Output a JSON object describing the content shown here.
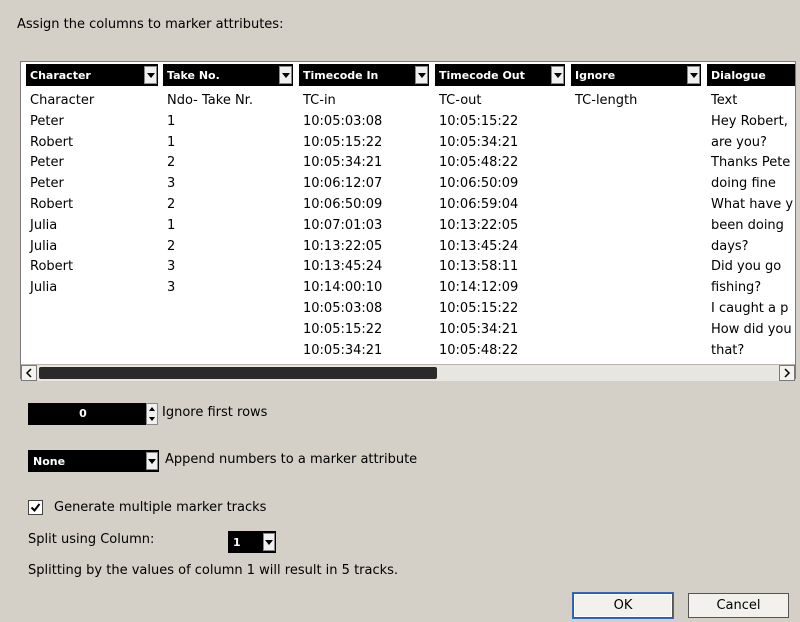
{
  "dialog": {
    "heading": "Assign the columns to marker attributes:"
  },
  "columns": [
    {
      "select": "Character",
      "cells": [
        "Character",
        "Peter",
        "Robert",
        "Peter",
        "Peter",
        "Robert",
        "Julia",
        "Julia",
        "Robert",
        "Julia",
        "",
        "",
        ""
      ]
    },
    {
      "select": "Take No.",
      "cells": [
        "Ndo- Take Nr.",
        "1",
        "1",
        "2",
        "3",
        "2",
        "1",
        "2",
        "3",
        "3",
        "",
        "",
        ""
      ]
    },
    {
      "select": "Timecode In",
      "cells": [
        "TC-in",
        "10:05:03:08",
        "10:05:15:22",
        "10:05:34:21",
        "10:06:12:07",
        "10:06:50:09",
        "10:07:01:03",
        "10:13:22:05",
        "10:13:45:24",
        "10:14:00:10",
        "10:05:03:08",
        "10:05:15:22",
        "10:05:34:21"
      ]
    },
    {
      "select": "Timecode Out",
      "cells": [
        "TC-out",
        "10:05:15:22",
        "10:05:34:21",
        "10:05:48:22",
        "10:06:50:09",
        "10:06:59:04",
        "10:13:22:05",
        "10:13:45:24",
        "10:13:58:11",
        "10:14:12:09",
        "10:05:15:22",
        "10:05:34:21",
        "10:05:48:22"
      ]
    },
    {
      "select": "Ignore",
      "cells": [
        "TC-length",
        "",
        "",
        "",
        "",
        "",
        "",
        "",
        "",
        "",
        "",
        "",
        ""
      ]
    },
    {
      "select": "Dialogue",
      "cells": [
        "Text",
        "Hey Robert,",
        "are you?",
        "Thanks Pete",
        "doing fine",
        "What have y",
        "been doing",
        "days?",
        "Did you go",
        "fishing?",
        "I caught a p",
        "How did you",
        "that?"
      ]
    }
  ],
  "ignore_rows": {
    "value": "0",
    "label": "Ignore first rows"
  },
  "append_numbers": {
    "value": "None",
    "label": "Append numbers to a marker attribute"
  },
  "multiple_tracks": {
    "checked": true,
    "label": "Generate multiple marker tracks"
  },
  "split": {
    "label": "Split using Column:",
    "value": "1"
  },
  "info": "Splitting by the values of column 1 will result in 5 tracks.",
  "buttons": {
    "ok": "OK",
    "cancel": "Cancel"
  },
  "icons": {
    "scroll_left": "arrow-left-icon",
    "scroll_right": "arrow-right-icon",
    "checkbox": "checkmark-icon"
  }
}
